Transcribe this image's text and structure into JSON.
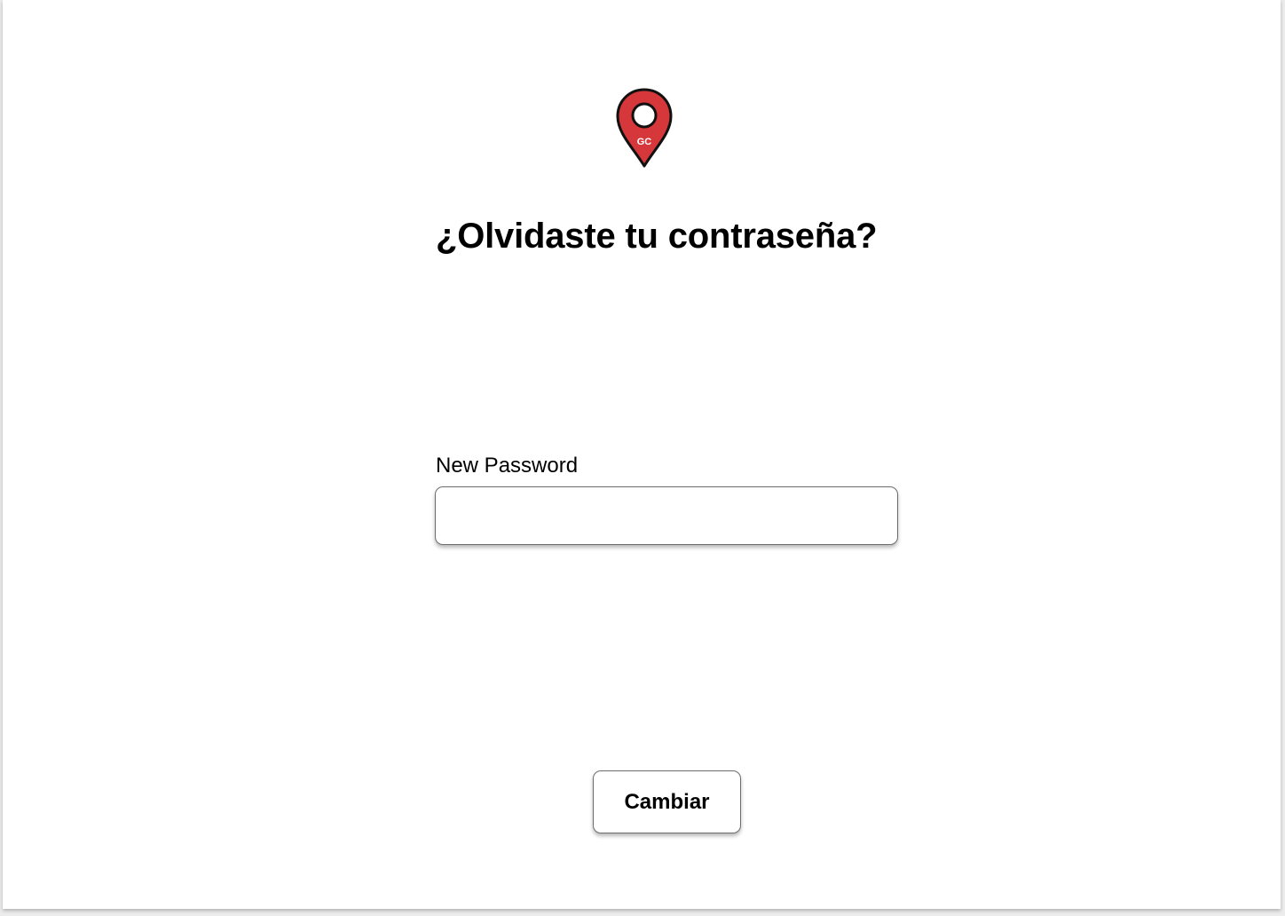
{
  "brand": {
    "logo_icon": "map-pin-icon",
    "logo_text": "GC",
    "pin_color": "#d6373a"
  },
  "page": {
    "title": "¿Olvidaste tu contraseña?"
  },
  "form": {
    "password_label": "New Password",
    "password_value": "",
    "submit_label": "Cambiar"
  }
}
